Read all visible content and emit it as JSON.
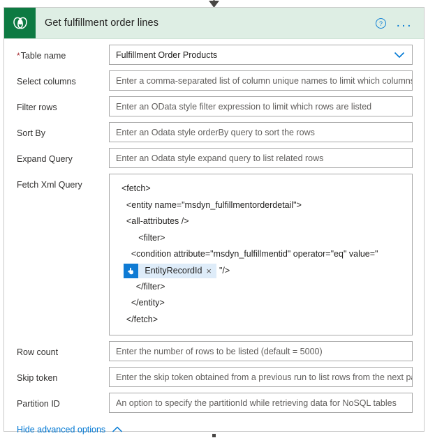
{
  "colors": {
    "connector_accent": "#0d7a42",
    "header_bg": "#deeee4",
    "icon_tile": "#0d7a42",
    "link_blue": "#0078d4",
    "token_chip_bg": "#deecf9",
    "token_icon_bg": "#0f7bd4",
    "required_star": "#a4262c",
    "field_border": "#a6a6a6"
  },
  "header": {
    "title": "Get fulfillment order lines",
    "connector_icon": "dataverse-icon",
    "help_icon": "help-circle-icon",
    "more_icon": "ellipsis-icon",
    "more_label": "..."
  },
  "fields": {
    "table_name": {
      "label": "Table name",
      "required": true,
      "required_marker": "*",
      "value": "Fulfillment Order Products",
      "chevron_icon": "chevron-down-icon"
    },
    "select_columns": {
      "label": "Select columns",
      "placeholder": "Enter a comma-separated list of column unique names to limit which columns a"
    },
    "filter_rows": {
      "label": "Filter rows",
      "placeholder": "Enter an OData style filter expression to limit which rows are listed"
    },
    "sort_by": {
      "label": "Sort By",
      "placeholder": "Enter an Odata style orderBy query to sort the rows"
    },
    "expand_query": {
      "label": "Expand Query",
      "placeholder": "Enter an Odata style expand query to list related rows"
    },
    "fetch_xml_query": {
      "label": "Fetch Xml Query",
      "lines_before": [
        "  <fetch>",
        "    <entity name=\"msdyn_fulfillmentorderdetail\">",
        "    <all-attributes />",
        "         <filter>",
        "      <condition attribute=\"msdyn_fulfillmentid\" operator=\"eq\" value=\""
      ],
      "token": {
        "label": "EntityRecordId",
        "icon": "manual-trigger-hand-icon",
        "close_label": "×"
      },
      "token_line_suffix": "\"/>",
      "lines_after": [
        "        </filter>",
        "      </entity>",
        "    </fetch>"
      ]
    },
    "row_count": {
      "label": "Row count",
      "placeholder": "Enter the number of rows to be listed (default = 5000)"
    },
    "skip_token": {
      "label": "Skip token",
      "placeholder": "Enter the skip token obtained from a previous run to list rows from the next pag"
    },
    "partition_id": {
      "label": "Partition ID",
      "placeholder": "An option to specify the partitionId while retrieving data for NoSQL tables"
    }
  },
  "footer": {
    "advanced_label": "Hide advanced options",
    "advanced_icon": "chevron-up-icon"
  }
}
